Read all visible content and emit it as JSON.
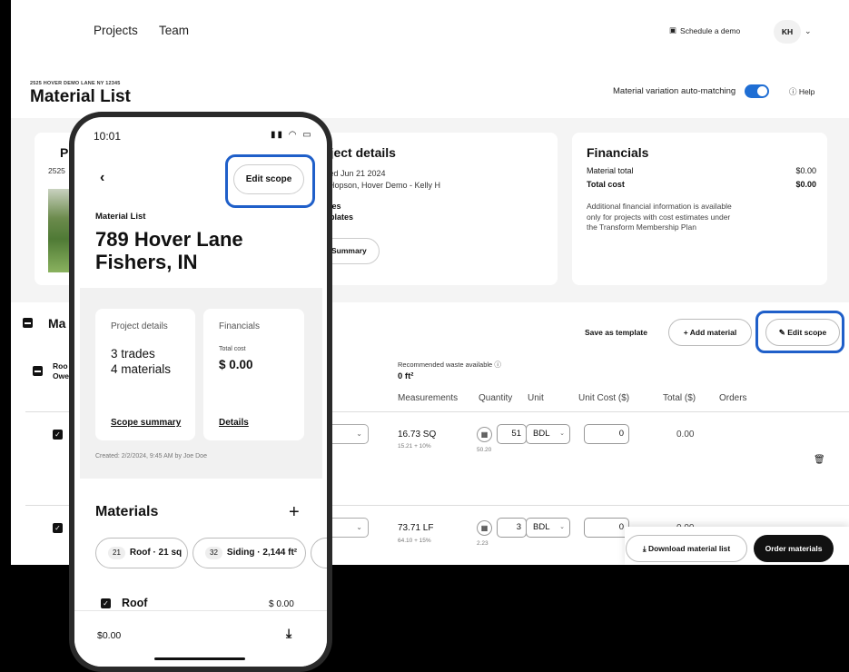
{
  "desktop": {
    "nav": {
      "projects": "Projects",
      "team": "Team",
      "schedule": "Schedule a demo",
      "avatar": "KH"
    },
    "address": "2525 HOVER DEMO LANE NY 12345",
    "title": "Material List",
    "automatch": "Material variation auto-matching",
    "help": "Help",
    "project_card": {
      "title": "Pro",
      "sub": "2525"
    },
    "details": {
      "title": "oject details",
      "created": "ated Jun 21 2024",
      "by": "y Hopson, Hover Demo - Kelly H",
      "trades": "ades",
      "templates": "mplates",
      "summary_btn": "Summary"
    },
    "financials": {
      "title": "Financials",
      "material_total_label": "Material total",
      "material_total": "$0.00",
      "total_cost_label": "Total cost",
      "total_cost": "$0.00",
      "note": "Additional financial information is available only for projects with cost estimates under the Transform Membership Plan"
    },
    "section": {
      "title": "Ma",
      "save_template": "Save as template",
      "add_material": "+ Add material",
      "edit_scope": "Edit scope"
    },
    "roof_group": {
      "line1": "Roo",
      "line2": "Owe",
      "waste_label": "Recommended waste available",
      "waste_value": "0 ft²"
    },
    "columns": [
      "Measurements",
      "Quantity",
      "Unit",
      "Unit Cost ($)",
      "Total ($)",
      "Orders"
    ],
    "rows": [
      {
        "meas": "16.73 SQ",
        "meas_sub": "15.21 + 10%",
        "calc_sub": "50.20",
        "qty": "51",
        "unit": "BDL",
        "unit_cost": "0",
        "total": "0.00"
      },
      {
        "meas": "73.71 LF",
        "meas_sub": "64.10 + 15%",
        "calc_sub": "2.23",
        "qty": "3",
        "unit": "BDL",
        "unit_cost": "0",
        "total": "0.00"
      }
    ],
    "download": "Download material list",
    "order": "Order materials"
  },
  "phone": {
    "time": "10:01",
    "edit_scope": "Edit scope",
    "label": "Material List",
    "address_line1": "789 Hover Lane",
    "address_line2": "Fishers, IN",
    "project_details": {
      "label": "Project details",
      "trades": "3 trades",
      "materials": "4 materials",
      "link": "Scope summary"
    },
    "financials": {
      "label": "Financials",
      "total_label": "Total cost",
      "total": "$ 0.00",
      "link": "Details"
    },
    "created": "Created: 2/2/2024, 9:45 AM by Joe Doe",
    "materials_title": "Materials",
    "chips": [
      {
        "count": "21",
        "label": "Roof · 21 sq"
      },
      {
        "count": "32",
        "label": "Siding · 2,144 ft²"
      }
    ],
    "roof": {
      "label": "Roof",
      "value": "$ 0.00"
    },
    "footer_total": "$0.00"
  },
  "colors": {
    "accent": "#1f6ed4",
    "highlight": "#1f5fc9",
    "dark": "#111111"
  }
}
